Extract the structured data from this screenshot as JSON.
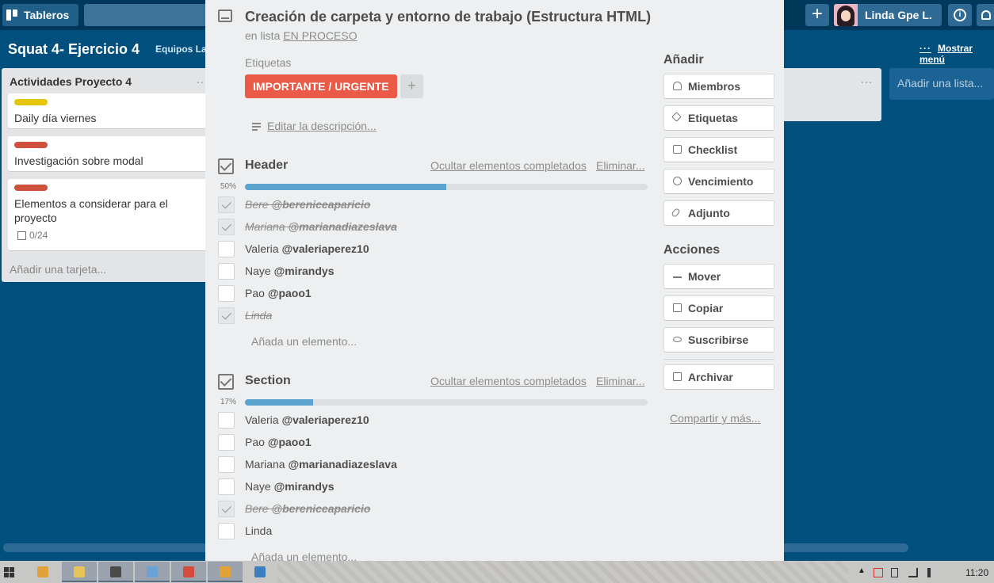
{
  "topbar": {
    "boards_label": "Tableros",
    "plus_label": "+",
    "user_name": "Linda Gpe L.",
    "info_label": "i"
  },
  "board": {
    "title": "Squat 4- Ejercicio 4",
    "team": "Equipos La",
    "show_menu": "Mostrar menú",
    "list_title": "Actividades Proyecto 4",
    "list_menu": "...",
    "cards": [
      {
        "label_color": "#e6c60d",
        "text": "Daily día viernes"
      },
      {
        "label_color": "#cf513d",
        "text": "Investigación sobre modal"
      },
      {
        "label_color": "#cf513d",
        "text": "Elementos a considerar para el proyecto",
        "badge": "0/24"
      }
    ],
    "add_card": "Añadir una tarjeta...",
    "add_list": "Añadir una lista..."
  },
  "modal": {
    "title": "Creación de carpeta y entorno de trabajo (Estructura HTML)",
    "in_list_prefix": "en lista",
    "in_list_name": "EN PROCESO",
    "labels_heading": "Etiquetas",
    "label_tag": "IMPORTANTE / URGENTE",
    "label_add": "+",
    "edit_description": "Editar la descripción...",
    "checklists": [
      {
        "title": "Header",
        "hide_completed": "Ocultar elementos completados",
        "delete": "Eliminar...",
        "percent_label": "50%",
        "progress": 0.5,
        "items": [
          {
            "name": "Bere",
            "handle": "@bereniceaparicio",
            "done": true
          },
          {
            "name": "Mariana",
            "handle": "@marianadiazeslava",
            "done": true
          },
          {
            "name": "Valeria",
            "handle": "@valeriaperez10",
            "done": false
          },
          {
            "name": "Naye",
            "handle": "@mirandys",
            "done": false
          },
          {
            "name": "Pao",
            "handle": "@paoo1",
            "done": false
          },
          {
            "name": "Linda",
            "handle": "",
            "done": true
          }
        ],
        "add_item": "Añada un elemento..."
      },
      {
        "title": "Section",
        "hide_completed": "Ocultar elementos completados",
        "delete": "Eliminar...",
        "percent_label": "17%",
        "progress": 0.17,
        "items": [
          {
            "name": "Valeria",
            "handle": "@valeriaperez10",
            "done": false
          },
          {
            "name": "Pao",
            "handle": "@paoo1",
            "done": false
          },
          {
            "name": "Mariana",
            "handle": "@marianadiazeslava",
            "done": false
          },
          {
            "name": "Naye",
            "handle": "@mirandys",
            "done": false
          },
          {
            "name": "Bere",
            "handle": "@bereniceaparicio",
            "done": true
          },
          {
            "name": "Linda",
            "handle": "",
            "done": false
          }
        ],
        "add_item": "Añada un elemento..."
      }
    ],
    "sidebar": {
      "add_heading": "Añadir",
      "add_buttons": [
        {
          "label": "Miembros",
          "icon": "member-icon"
        },
        {
          "label": "Etiquetas",
          "icon": "tag-icon"
        },
        {
          "label": "Checklist",
          "icon": "checklist-icon"
        },
        {
          "label": "Vencimiento",
          "icon": "clock-icon"
        },
        {
          "label": "Adjunto",
          "icon": "paperclip-icon"
        }
      ],
      "actions_heading": "Acciones",
      "action_buttons": [
        {
          "label": "Mover",
          "icon": "arrow-right-icon"
        },
        {
          "label": "Copiar",
          "icon": "copy-icon"
        },
        {
          "label": "Suscribirse",
          "icon": "eye-icon"
        }
      ],
      "archive_button": {
        "label": "Archivar",
        "icon": "archive-icon"
      },
      "share": "Compartir y más..."
    }
  },
  "taskbar": {
    "apps": [
      {
        "icon": "git-icon",
        "color": "#e2a23a"
      },
      {
        "icon": "folder-icon",
        "color": "#e8c35a"
      },
      {
        "icon": "sublime-icon",
        "color": "#4a4a4a"
      },
      {
        "icon": "paint-icon",
        "color": "#6aa3d8"
      },
      {
        "icon": "chrome-icon",
        "color": "#d54b3d"
      },
      {
        "icon": "git-icon",
        "color": "#e2a23a"
      },
      {
        "icon": "window-icon",
        "color": "#3c7fc1"
      }
    ],
    "clock": "11:20"
  }
}
